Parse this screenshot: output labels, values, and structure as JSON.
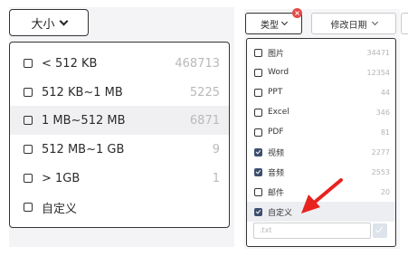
{
  "size_filter": {
    "button_label": "大小",
    "options": [
      {
        "label": "< 512 KB",
        "count": "468713"
      },
      {
        "label": "512 KB~1 MB",
        "count": "5225"
      },
      {
        "label": "1 MB~512 MB",
        "count": "6871"
      },
      {
        "label": "512 MB~1 GB",
        "count": "9"
      },
      {
        "label": ">  1GB",
        "count": "1"
      },
      {
        "label": "自定义",
        "count": ""
      }
    ]
  },
  "type_filter": {
    "button_label": "类型",
    "clear_badge": "×",
    "date_button_label": "修改日期",
    "options": [
      {
        "label": "图片",
        "count": "34471",
        "checked": false
      },
      {
        "label": "Word",
        "count": "12354",
        "checked": false
      },
      {
        "label": "PPT",
        "count": "44",
        "checked": false
      },
      {
        "label": "Excel",
        "count": "346",
        "checked": false
      },
      {
        "label": "PDF",
        "count": "81",
        "checked": false
      },
      {
        "label": "视频",
        "count": "2277",
        "checked": true
      },
      {
        "label": "音频",
        "count": "2553",
        "checked": true
      },
      {
        "label": "邮件",
        "count": "20",
        "checked": false
      },
      {
        "label": "自定义",
        "count": "",
        "checked": true
      }
    ],
    "custom_ext_placeholder": ".txt"
  },
  "colors": {
    "accent": "#3d4f6e",
    "annotation_arrow": "#e8231f"
  }
}
